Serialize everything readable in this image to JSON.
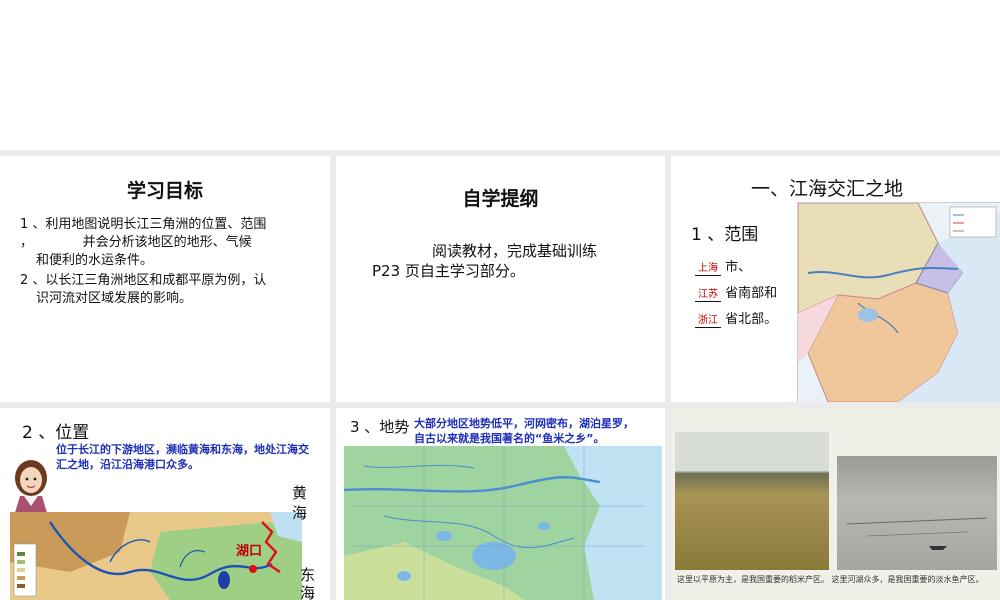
{
  "slides": {
    "goals": {
      "title": "学习目标",
      "item1_line1": "1 、利用地图说明长江三角洲的位置、范围",
      "item1_line2": "，            并会分析该地区的地形、气候",
      "item1_line3": "和便利的水运条件。",
      "item2_line1": "2 、以长江三角洲地区和成都平原为例，认",
      "item2_line2": "识河流对区域发展的影响。"
    },
    "outline": {
      "title": "自学提纲",
      "line1": "阅读教材，完成基础训练",
      "line2": "P23 页自主学习部分。"
    },
    "scope": {
      "title": "一、江海交汇之地",
      "subtitle": "1 、范围",
      "shanghai": "上海",
      "shanghai_suffix": "市、",
      "jiangsu": "江苏",
      "jiangsu_suffix": "省南部和",
      "zhejiang": "浙江",
      "zhejiang_suffix": "省北部。"
    },
    "location": {
      "title": "2 、位置",
      "desc": "位于长江的下游地区，濒临黄海和东海，地处江海交汇之地，沿江沿海港口众多。",
      "huang": "黄",
      "hai1": "海",
      "dong": "东",
      "hai2": "海",
      "hukou": "湖口"
    },
    "terrain": {
      "title": "3 、地势",
      "desc": "大部分地区地势低平，河网密布，湖泊星罗，自古以来就是我国著名的“鱼米之乡”。"
    },
    "photos": {
      "caption": "这里以平原为主，是我国重要的稻米产区。  这里河湖众多，是我国重要的淡水鱼产区。"
    }
  },
  "colors": {
    "accent_red": "#c00000",
    "text_blue": "#1f2fb8",
    "background": "#ebebeb"
  }
}
